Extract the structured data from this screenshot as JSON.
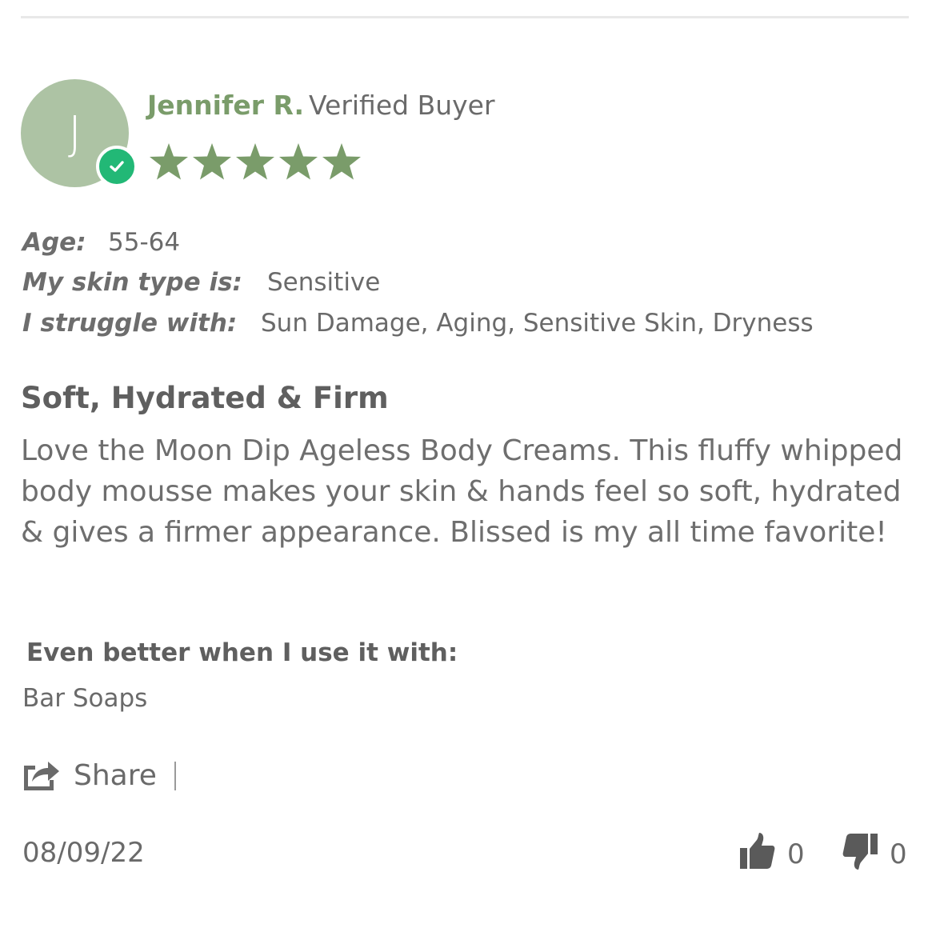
{
  "review": {
    "avatar_initial": "J",
    "reviewer_name": "Jennifer R.",
    "verified_label": "Verified Buyer",
    "rating": 5,
    "rating_max": 5,
    "attributes": [
      {
        "label": "Age:",
        "value": "55-64"
      },
      {
        "label": "My skin type is:",
        "value": "Sensitive"
      },
      {
        "label": "I struggle with:",
        "value": "Sun Damage, Aging, Sensitive Skin, Dryness"
      }
    ],
    "title": "Soft, Hydrated & Firm",
    "body": "Love the Moon Dip Ageless Body Creams. This fluffy whipped body mousse makes your skin & hands feel so soft, hydrated & gives a firmer appearance. Blissed is my all time favorite!",
    "better_with_label": "Even better when I use it with:",
    "better_with_value": "Bar Soaps",
    "share_label": "Share",
    "date": "08/09/22",
    "helpful_yes": "0",
    "helpful_no": "0"
  },
  "colors": {
    "accent_green": "#7a9c6a",
    "avatar_bg": "#adc3a4",
    "verified_badge": "#22b876",
    "text": "#6a6a6a"
  },
  "icons": {
    "badge": "checkmark-icon",
    "star": "star-icon",
    "share": "share-icon",
    "up": "thumbs-up-icon",
    "down": "thumbs-down-icon"
  }
}
